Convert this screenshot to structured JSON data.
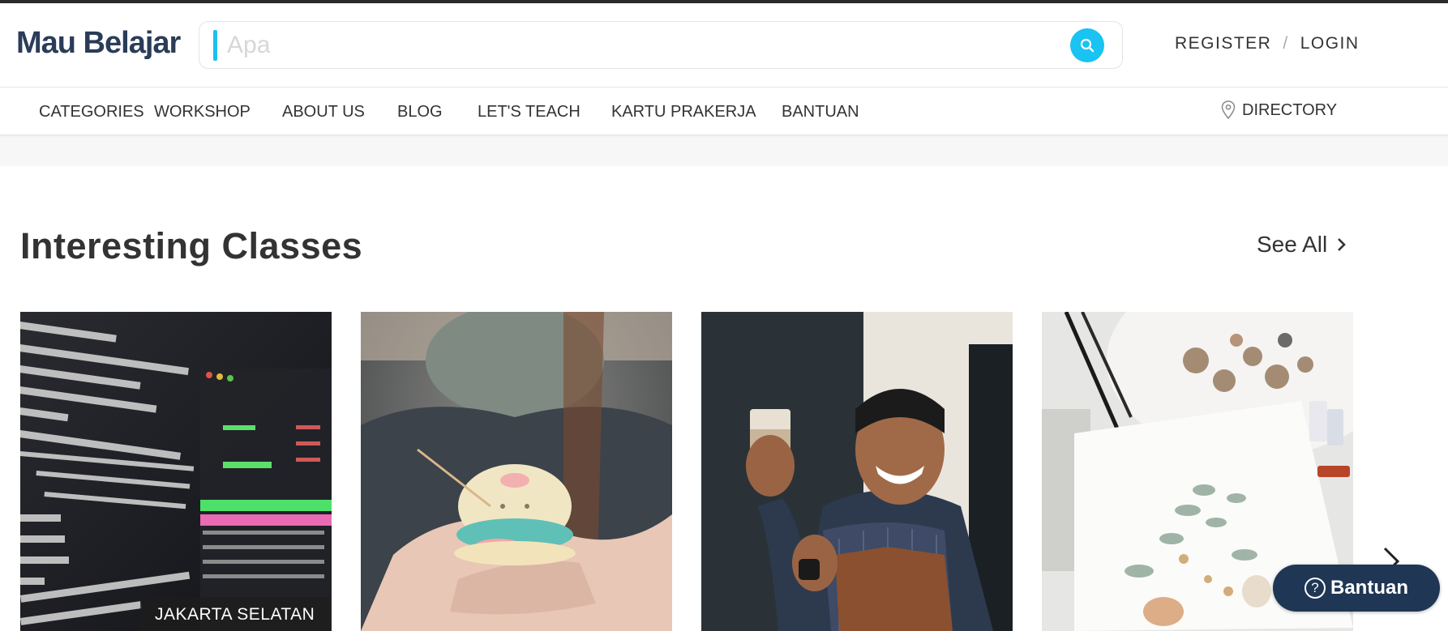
{
  "header": {
    "logo_text": "Mau Belajar",
    "search": {
      "placeholder": "Apa",
      "value": ""
    },
    "register_label": "REGISTER",
    "separator": "/",
    "login_label": "LOGIN"
  },
  "nav": {
    "items": [
      {
        "label": "CATEGORIES"
      },
      {
        "label": "WORKSHOP"
      },
      {
        "label": "ABOUT US"
      },
      {
        "label": "BLOG"
      },
      {
        "label": "LET'S TEACH"
      },
      {
        "label": "KARTU PRAKERJA"
      },
      {
        "label": "BANTUAN"
      }
    ],
    "directory_label": "DIRECTORY"
  },
  "section": {
    "title": "Interesting Classes",
    "see_all_label": "See All"
  },
  "cards": [
    {
      "image": "terminal-screen-photo",
      "location": "JAKARTA SELATAN"
    },
    {
      "image": "bread-decorating-photo"
    },
    {
      "image": "barista-coffee-photo"
    },
    {
      "image": "watercolor-painting-photo"
    }
  ],
  "help_button": {
    "label": "Bantuan",
    "icon": "question-circle-icon"
  },
  "colors": {
    "accent": "#19c3f2",
    "brand": "#2a3c58",
    "help_bg": "#1f3654"
  }
}
